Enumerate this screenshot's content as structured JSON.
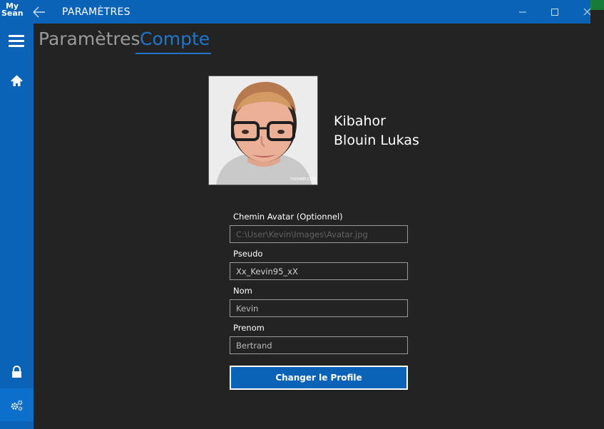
{
  "app": {
    "logo_line1": "My",
    "logo_line2": "Sean",
    "title": "PARAMÈTRES"
  },
  "header": {
    "tab_parametres": "Paramètres",
    "tab_compte": "Compte"
  },
  "profile": {
    "pseudo": "Kibahor",
    "full_name": "Blouin Lukas",
    "avatar_watermark": "TOONME.COM"
  },
  "form": {
    "avatar_label": "Chemin Avatar (Optionnel)",
    "avatar_placeholder": "C:\\User\\Kevin\\Images\\Avatar.jpg",
    "pseudo_label": "Pseudo",
    "pseudo_value": "Xx_Kevin95_xX",
    "nom_label": "Nom",
    "nom_value": "Kevin",
    "prenom_label": "Prenom",
    "prenom_value": "Bertrand",
    "submit_label": "Changer le Profile"
  },
  "icons": {
    "back": "arrow-left-icon",
    "minimize": "minimize-icon",
    "maximize": "maximize-icon",
    "close": "close-icon",
    "menu": "hamburger-icon",
    "home": "home-icon",
    "lock": "lock-icon",
    "settings": "gears-icon"
  },
  "colors": {
    "accent": "#0a63b7",
    "background": "#232323",
    "tab_active": "#1f76cf",
    "tab_inactive": "#9a9a9a"
  }
}
